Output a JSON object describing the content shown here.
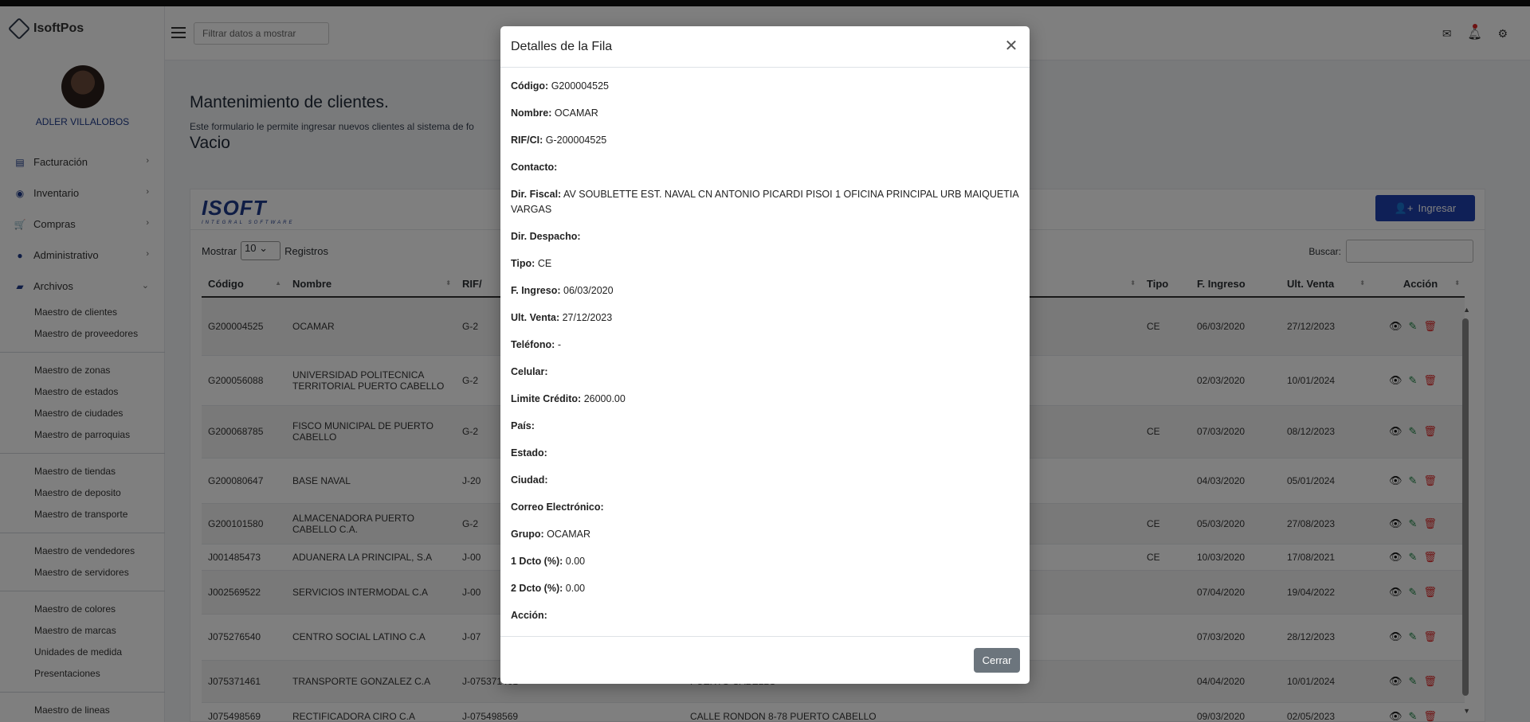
{
  "app": {
    "name": "IsoftPos",
    "user": "ADLER VILLALOBOS"
  },
  "header": {
    "filter_placeholder": "Filtrar datos a mostrar"
  },
  "sidebar": {
    "items": [
      {
        "label": "Facturación",
        "icon": "document-icon"
      },
      {
        "label": "Inventario",
        "icon": "database-icon"
      },
      {
        "label": "Compras",
        "icon": "cart-icon"
      },
      {
        "label": "Administrativo",
        "icon": "person-icon"
      },
      {
        "label": "Archivos",
        "icon": "folder-icon"
      }
    ],
    "archivos_groups": [
      [
        "Maestro de clientes",
        "Maestro de proveedores"
      ],
      [
        "Maestro de zonas",
        "Maestro de estados",
        "Maestro de ciudades",
        "Maestro de parroquias"
      ],
      [
        "Maestro de tiendas",
        "Maestro de deposito",
        "Maestro de transporte"
      ],
      [
        "Maestro de vendedores",
        "Maestro de servidores"
      ],
      [
        "Maestro de colores",
        "Maestro de marcas",
        "Unidades de medida",
        "Presentaciones"
      ],
      [
        "Maestro de lineas"
      ]
    ]
  },
  "main": {
    "title": "Mantenimiento de clientes.",
    "subtitle": "Este formulario le permite ingresar nuevos clientes al sistema de fo",
    "status": "Vacio",
    "logo_text": "ISOFT",
    "logo_sub": "INTEGRAL SOFTWARE",
    "ingresar_label": "Ingresar",
    "mostrar_label": "Mostrar",
    "mostrar_value": "10",
    "registros_label": "Registros",
    "buscar_label": "Buscar:"
  },
  "table": {
    "headers": [
      "Código",
      "Nombre",
      "RIF/",
      "",
      "Tipo",
      "F. Ingreso",
      "Ult. Venta",
      "Acción"
    ],
    "rows": [
      [
        "G200004525",
        "OCAMAR",
        "G-2",
        "",
        "CE",
        "06/03/2020",
        "27/12/2023"
      ],
      [
        "G200056088",
        "UNIVERSIDAD POLITECNICA TERRITORIAL PUERTO CABELLO",
        "G-2",
        "",
        "",
        "02/03/2020",
        "10/01/2024"
      ],
      [
        "G200068785",
        "FISCO MUNICIPAL DE PUERTO CABELLO",
        "G-2",
        "",
        "CE",
        "07/03/2020",
        "08/12/2023"
      ],
      [
        "G200080647",
        "BASE NAVAL",
        "J-20",
        "",
        "",
        "04/03/2020",
        "05/01/2024"
      ],
      [
        "G200101580",
        "ALMACENADORA PUERTO CABELLO C.A.",
        "G-2",
        "",
        "CE",
        "05/03/2020",
        "27/08/2023"
      ],
      [
        "J001485473",
        "ADUANERA LA PRINCIPAL, S.A",
        "J-00",
        "",
        "CE",
        "10/03/2020",
        "17/08/2021"
      ],
      [
        "J002569522",
        "SERVICIOS INTERMODAL C.A",
        "J-00",
        "",
        "",
        "07/04/2020",
        "19/04/2022"
      ],
      [
        "J075276540",
        "CENTRO SOCIAL LATINO C.A",
        "J-07",
        "",
        "",
        "07/03/2020",
        "28/12/2023"
      ],
      [
        "J075371461",
        "TRANSPORTE GONZALEZ C.A",
        "J-075371461",
        "PUERTO CABELLO",
        "",
        "04/04/2020",
        "10/01/2024"
      ],
      [
        "J075498569",
        "RECTIFICADORA CIRO C.A",
        "J-075498569",
        "CALLE RONDON 8-78 PUERTO CABELLO",
        "",
        "09/03/2020",
        "02/05/2023"
      ]
    ]
  },
  "modal": {
    "title": "Detalles de la Fila",
    "fields": [
      {
        "label": "Código:",
        "value": "G200004525"
      },
      {
        "label": "Nombre:",
        "value": "OCAMAR"
      },
      {
        "label": "RIF/CI:",
        "value": "G-200004525"
      },
      {
        "label": "Contacto:",
        "value": ""
      },
      {
        "label": "Dir. Fiscal:",
        "value": "AV SOUBLETTE EST. NAVAL CN ANTONIO PICARDI PISOI 1 OFICINA PRINCIPAL URB MAIQUETIA VARGAS"
      },
      {
        "label": "Dir. Despacho:",
        "value": ""
      },
      {
        "label": "Tipo:",
        "value": "CE"
      },
      {
        "label": "F. Ingreso:",
        "value": "06/03/2020"
      },
      {
        "label": "Ult. Venta:",
        "value": "27/12/2023"
      },
      {
        "label": "Teléfono:",
        "value": "-"
      },
      {
        "label": "Celular:",
        "value": ""
      },
      {
        "label": "Limite Crédito:",
        "value": "26000.00"
      },
      {
        "label": "País:",
        "value": ""
      },
      {
        "label": "Estado:",
        "value": ""
      },
      {
        "label": "Ciudad:",
        "value": ""
      },
      {
        "label": "Correo Electrónico:",
        "value": ""
      },
      {
        "label": "Grupo:",
        "value": "OCAMAR"
      },
      {
        "label": "1 Dcto (%):",
        "value": "0.00"
      },
      {
        "label": "2 Dcto (%):",
        "value": "0.00"
      },
      {
        "label": "Acción:",
        "value": ""
      }
    ],
    "close_label": "Cerrar"
  }
}
